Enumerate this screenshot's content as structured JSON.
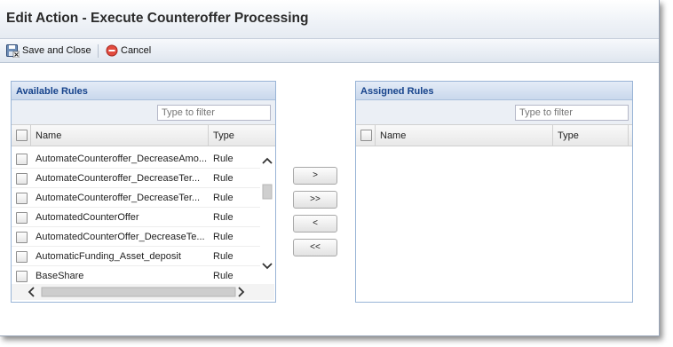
{
  "window": {
    "title": "Edit Action - Execute Counteroffer Processing"
  },
  "toolbar": {
    "save_label": "Save and Close",
    "cancel_label": "Cancel"
  },
  "available": {
    "title": "Available Rules",
    "filter_placeholder": "Type to filter",
    "columns": {
      "name": "Name",
      "type": "Type"
    },
    "rows": [
      {
        "name": "AutomateCounteroffer_DecreaseAmo...",
        "type": "Rule"
      },
      {
        "name": "AutomateCounteroffer_DecreaseTer...",
        "type": "Rule"
      },
      {
        "name": "AutomateCounteroffer_DecreaseTer...",
        "type": "Rule"
      },
      {
        "name": "AutomatedCounterOffer",
        "type": "Rule"
      },
      {
        "name": "AutomatedCounterOffer_DecreaseTe...",
        "type": "Rule"
      },
      {
        "name": "AutomaticFunding_Asset_deposit",
        "type": "Rule"
      },
      {
        "name": "BaseShare",
        "type": "Rule"
      }
    ]
  },
  "transfer": {
    "add": ">",
    "add_all": ">>",
    "remove": "<",
    "remove_all": "<<"
  },
  "assigned": {
    "title": "Assigned Rules",
    "filter_placeholder": "Type to filter",
    "columns": {
      "name": "Name",
      "type": "Type"
    }
  },
  "colors": {
    "panel_header_text": "#15428b",
    "panel_border": "#99b4d6",
    "cancel_icon": "#d93a32"
  }
}
